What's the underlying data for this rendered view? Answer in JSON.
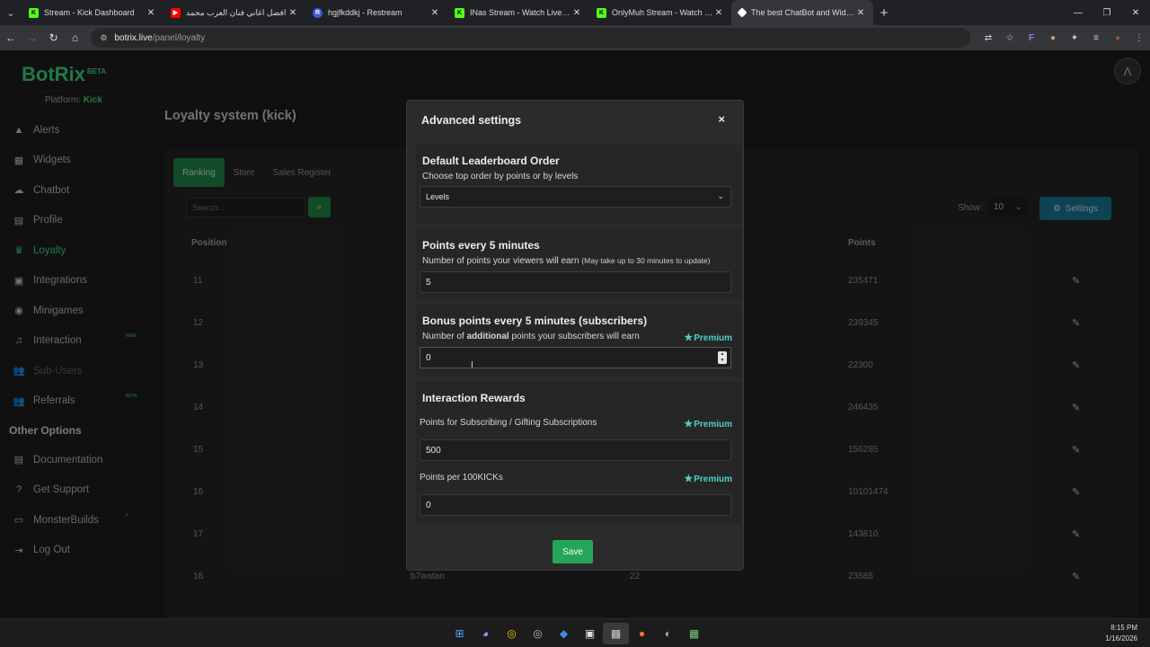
{
  "browser": {
    "tabs": [
      {
        "title": "Stream - Kick Dashboard",
        "fav_color": "#53fc18"
      },
      {
        "title": "افضل اغاني فنان العرب محمد",
        "fav_color": "#ff0000"
      },
      {
        "title": "hgjfkddkj - Restream",
        "fav_color": "#3b5bdb"
      },
      {
        "title": "INas Stream - Watch Live on Ki",
        "fav_color": "#53fc18"
      },
      {
        "title": "OnlyMuh Stream - Watch Live o",
        "fav_color": "#53fc18"
      },
      {
        "title": "The best ChatBot and Widgets",
        "fav_color": "#ffffff"
      }
    ],
    "url_host": "botrix.live",
    "url_path": "/panel/loyalty"
  },
  "app": {
    "logo": "BotRix",
    "logo_badge": "BETA",
    "platform_label": "Platform:",
    "platform_value": "Kick",
    "sidebar": [
      {
        "label": "Alerts",
        "icon": "warning-icon"
      },
      {
        "label": "Widgets",
        "icon": "grid-icon"
      },
      {
        "label": "Chatbot",
        "icon": "cloud-icon"
      },
      {
        "label": "Profile",
        "icon": "id-card-icon"
      },
      {
        "label": "Loyalty",
        "icon": "trophy-icon"
      },
      {
        "label": "Integrations",
        "icon": "plug-icon"
      },
      {
        "label": "Minigames",
        "icon": "gamepad-icon"
      },
      {
        "label": "Interaction",
        "icon": "music-icon",
        "badge": "NEW"
      },
      {
        "label": "Sub-Users",
        "icon": "users-icon"
      },
      {
        "label": "Referrals",
        "icon": "users-icon",
        "badge": "BETA"
      }
    ],
    "other_heading": "Other Options",
    "other": [
      {
        "label": "Documentation",
        "icon": "book-icon"
      },
      {
        "label": "Get Support",
        "icon": "help-icon"
      },
      {
        "label": "MonsterBuilds",
        "icon": "monitor-icon"
      },
      {
        "label": "Log Out",
        "icon": "logout-icon"
      }
    ],
    "page_title": "Loyalty system (kick)",
    "tabs": [
      "Ranking",
      "Store",
      "Sales Register"
    ],
    "search_placeholder": "Search...",
    "show_label": "Show:",
    "show_value": "10",
    "settings_label": "Settings",
    "col_position": "Position",
    "col_points": "Points",
    "rows": [
      {
        "pos": "11",
        "name": "",
        "level": "",
        "points": "235471"
      },
      {
        "pos": "12",
        "name": "",
        "level": "",
        "points": "239345"
      },
      {
        "pos": "13",
        "name": "",
        "level": "",
        "points": "22300"
      },
      {
        "pos": "14",
        "name": "",
        "level": "",
        "points": "246435"
      },
      {
        "pos": "15",
        "name": "",
        "level": "",
        "points": "156285"
      },
      {
        "pos": "16",
        "name": "",
        "level": "",
        "points": "10101474"
      },
      {
        "pos": "17",
        "name": "",
        "level": "",
        "points": "143810"
      },
      {
        "pos": "18",
        "name": "b7watan",
        "level": "22",
        "points": "23585"
      }
    ]
  },
  "modal": {
    "title": "Advanced settings",
    "close": "×",
    "leaderboard": {
      "heading": "Default Leaderboard Order",
      "desc": "Choose top order by points or by levels",
      "value": "Levels"
    },
    "points": {
      "heading": "Points every 5 minutes",
      "desc": "Number of points your viewers will earn",
      "note": "(May take up to 30 minutes to update)",
      "value": "5"
    },
    "bonus": {
      "heading": "Bonus points every 5 minutes (subscribers)",
      "desc_a": "Number of",
      "desc_b": "additional",
      "desc_c": "points your subscribers will earn",
      "premium": "Premium",
      "value": "0"
    },
    "interaction": {
      "heading": "Interaction Rewards",
      "sub_label": "Points for Subscribing / Gifting Subscriptions",
      "sub_premium": "Premium",
      "sub_value": "500",
      "kicks_label": "Points per 100KICKs",
      "kicks_premium": "Premium",
      "kicks_value": "0"
    },
    "save": "Save"
  },
  "taskbar": {
    "time": "8:15 PM",
    "date": "1/16/2026"
  },
  "colors": {
    "accent": "#3ddc84",
    "premium": "#4fd0c8",
    "save": "#25a55a"
  }
}
